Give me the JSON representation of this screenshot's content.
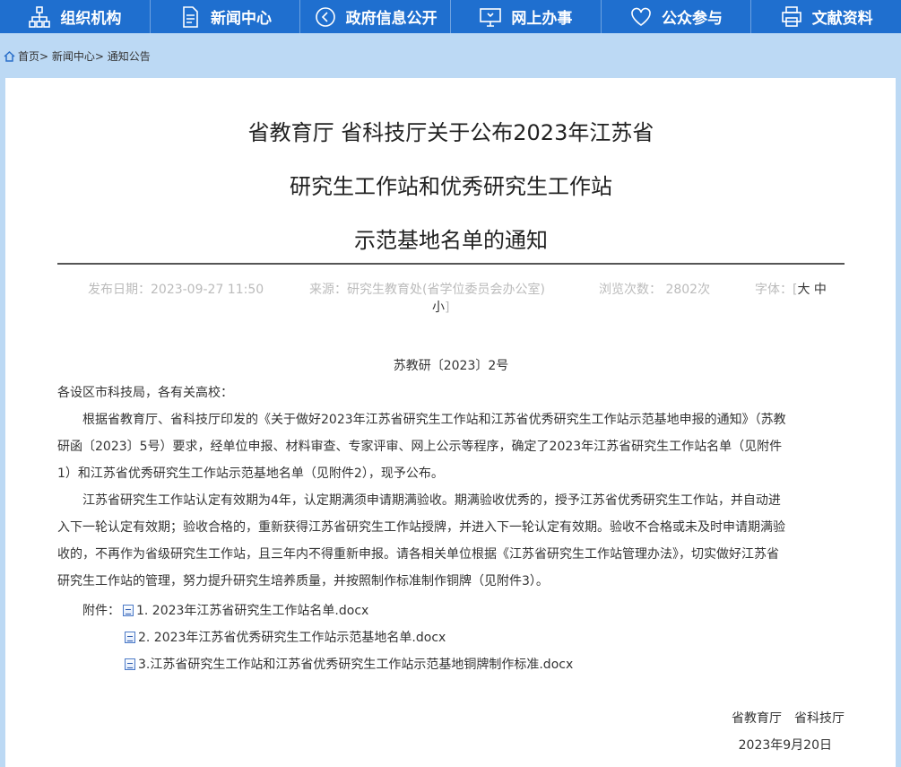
{
  "nav": [
    {
      "label": "组织机构",
      "icon": "org-chart-icon"
    },
    {
      "label": "新闻中心",
      "icon": "document-icon"
    },
    {
      "label": "政府信息公开",
      "icon": "play-circle-icon"
    },
    {
      "label": "网上办事",
      "icon": "monitor-icon"
    },
    {
      "label": "公众参与",
      "icon": "heart-icon"
    },
    {
      "label": "文献资料",
      "icon": "printer-icon"
    }
  ],
  "breadcrumb": {
    "text": "首页> 新闻中心> 通知公告",
    "icon": "home-icon"
  },
  "article": {
    "title_line1": "省教育厅 省科技厅关于公布2023年江苏省",
    "title_line2": "研究生工作站和优秀研究生工作站",
    "title_line3": "示范基地名单的通知",
    "publish_date": "发布日期：2023-09-27 11:50",
    "source": "来源：研究生教育处(省学位委员会办公室)",
    "views": "浏览次数： 2802次",
    "font_label": "字体：[",
    "font_large": "大",
    "font_medium": "中",
    "font_small": "小",
    "font_close": "]",
    "doc_number": "苏教研〔2023〕2号",
    "salutation": "各设区市科技局，各有关高校：",
    "para1_l1": "根据省教育厅、省科技厅印发的《关于做好2023年江苏省研究生工作站和江苏省优秀研究生工作站示范基地申报的通知》（苏教",
    "para1_l2": "研函〔2023〕5号）要求，经单位申报、材料审查、专家评审、网上公示等程序，确定了2023年江苏省研究生工作站名单（见附件",
    "para1_l3": "1）和江苏省优秀研究生工作站示范基地名单（见附件2），现予公布。",
    "para2_l1": "江苏省研究生工作站认定有效期为4年，认定期满须申请期满验收。期满验收优秀的，授予江苏省优秀研究生工作站，并自动进",
    "para2_l2": "入下一轮认定有效期；验收合格的，重新获得江苏省研究生工作站授牌，并进入下一轮认定有效期。验收不合格或未及时申请期满验",
    "para2_l3": "收的，不再作为省级研究生工作站，且三年内不得重新申报。请各相关单位根据《江苏省研究生工作站管理办法》，切实做好江苏省",
    "para2_l4": "研究生工作站的管理，努力提升研究生培养质量，并按照制作标准制作铜牌（见附件3）。",
    "attachments_label": "附件：",
    "attachments": [
      "1. 2023年江苏省研究生工作站名单.docx",
      "2. 2023年江苏省优秀研究生工作站示范基地名单.docx",
      "3.江苏省研究生工作站和江苏省优秀研究生工作站示范基地铜牌制作标准.docx"
    ],
    "signatory": "省教育厅　省科技厅",
    "sign_date": "2023年9月20日"
  }
}
